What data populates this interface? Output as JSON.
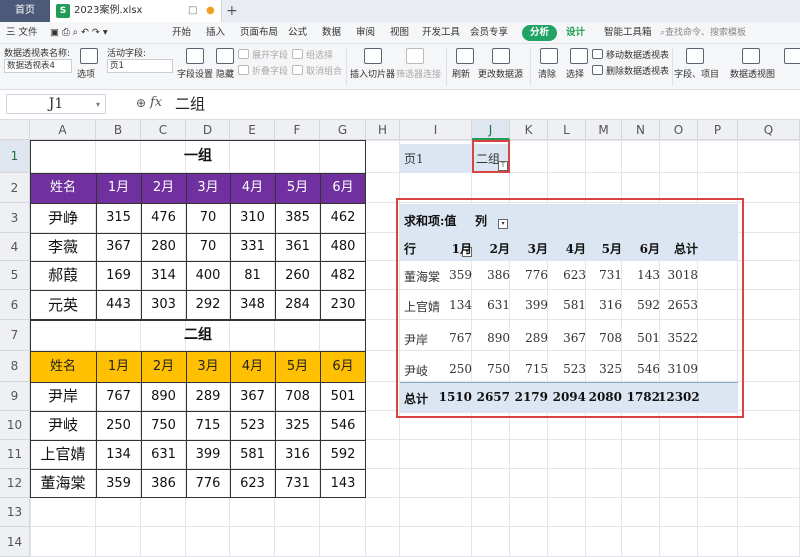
{
  "titlebar": {
    "home_tab": "首页",
    "file_tab": "2023案例.xlsx",
    "file_icon": "S",
    "add_tab": "+"
  },
  "menu": {
    "file": "三 文件",
    "items": [
      "开始",
      "插入",
      "页面布局",
      "公式",
      "数据",
      "审阅",
      "视图",
      "开发工具",
      "会员专享"
    ],
    "active": "分析",
    "design": "设计",
    "smart": "智能工具箱",
    "search": "查找命令、搜索模板"
  },
  "ribbon": {
    "pivot_name_label": "数据透视表名称:",
    "pivot_name_value": "数据透视表4",
    "options": "选项",
    "active_field_label": "活动字段:",
    "active_field_value": "页1",
    "field_settings": "字段设置",
    "hide": "隐藏",
    "expand_field": "展开字段",
    "collapse_field": "折叠字段",
    "group_selection": "组选择",
    "ungroup": "取消组合",
    "insert_slicer": "插入切片器",
    "filter_connections": "筛选器连接",
    "refresh": "刷新",
    "change_source": "更改数据源",
    "clear": "清除",
    "select": "选择",
    "move_pivot": "移动数据透视表",
    "delete_pivot": "删除数据透视表",
    "fields_items": "字段、项目",
    "pivot_chart": "数据透视图"
  },
  "formula": {
    "cell_ref": "J1",
    "fx": "fx",
    "value": "二组"
  },
  "columns": [
    "A",
    "B",
    "C",
    "D",
    "E",
    "F",
    "G",
    "H",
    "I",
    "J",
    "K",
    "L",
    "M",
    "N",
    "O",
    "P",
    "Q"
  ],
  "rows": [
    "1",
    "2",
    "3",
    "4",
    "5",
    "6",
    "7",
    "8",
    "9",
    "10",
    "11",
    "12",
    "13",
    "14"
  ],
  "group1": {
    "title": "一组",
    "headers": [
      "姓名",
      "1月",
      "2月",
      "3月",
      "4月",
      "5月",
      "6月"
    ],
    "rows": [
      [
        "尹峥",
        "315",
        "476",
        "70",
        "310",
        "385",
        "462"
      ],
      [
        "李薇",
        "367",
        "280",
        "70",
        "331",
        "361",
        "480"
      ],
      [
        "郝葭",
        "169",
        "314",
        "400",
        "81",
        "260",
        "482"
      ],
      [
        "元英",
        "443",
        "303",
        "292",
        "348",
        "284",
        "230"
      ]
    ]
  },
  "group2": {
    "title": "二组",
    "headers": [
      "姓名",
      "1月",
      "2月",
      "3月",
      "4月",
      "5月",
      "6月"
    ],
    "rows": [
      [
        "尹岸",
        "767",
        "890",
        "289",
        "367",
        "708",
        "501"
      ],
      [
        "尹岐",
        "250",
        "750",
        "715",
        "523",
        "325",
        "546"
      ],
      [
        "上官婧",
        "134",
        "631",
        "399",
        "581",
        "316",
        "592"
      ],
      [
        "董海棠",
        "359",
        "386",
        "776",
        "623",
        "731",
        "143"
      ]
    ]
  },
  "pagefield": {
    "label": "页1",
    "value": "二组"
  },
  "pivot": {
    "header_value": "求和项:值",
    "header_col": "列",
    "row_label": "行",
    "columns": [
      "1月",
      "2月",
      "3月",
      "4月",
      "5月",
      "6月",
      "总计"
    ],
    "rows": [
      {
        "name": "董海棠",
        "values": [
          "359",
          "386",
          "776",
          "623",
          "731",
          "143",
          "3018"
        ]
      },
      {
        "name": "上官婧",
        "values": [
          "134",
          "631",
          "399",
          "581",
          "316",
          "592",
          "2653"
        ]
      },
      {
        "name": "尹岸",
        "values": [
          "767",
          "890",
          "289",
          "367",
          "708",
          "501",
          "3522"
        ]
      },
      {
        "name": "尹岐",
        "values": [
          "250",
          "750",
          "715",
          "523",
          "325",
          "546",
          "3109"
        ]
      }
    ],
    "total_label": "总计",
    "totals": [
      "1510",
      "2657",
      "2179",
      "2094",
      "2080",
      "1782",
      "12302"
    ]
  },
  "colors": {
    "purple": "#7030a0",
    "yellow": "#ffc000",
    "accent_green": "#21a366",
    "highlight_red": "#d64541",
    "pivot_band": "#dce6f2"
  }
}
